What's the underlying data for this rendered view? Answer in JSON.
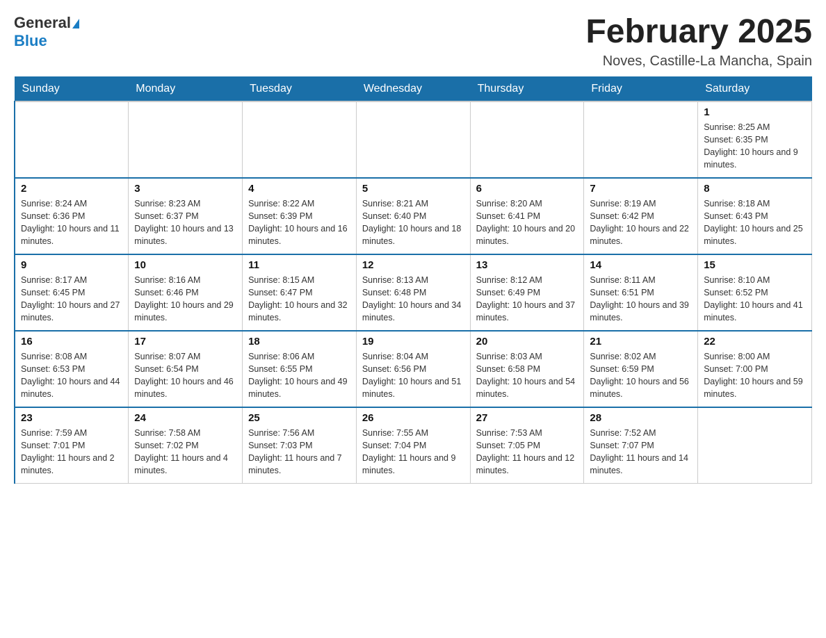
{
  "header": {
    "logo_general": "General",
    "logo_blue": "Blue",
    "title": "February 2025",
    "subtitle": "Noves, Castille-La Mancha, Spain"
  },
  "days_of_week": [
    "Sunday",
    "Monday",
    "Tuesday",
    "Wednesday",
    "Thursday",
    "Friday",
    "Saturday"
  ],
  "weeks": [
    [
      {
        "day": "",
        "info": ""
      },
      {
        "day": "",
        "info": ""
      },
      {
        "day": "",
        "info": ""
      },
      {
        "day": "",
        "info": ""
      },
      {
        "day": "",
        "info": ""
      },
      {
        "day": "",
        "info": ""
      },
      {
        "day": "1",
        "info": "Sunrise: 8:25 AM\nSunset: 6:35 PM\nDaylight: 10 hours and 9 minutes."
      }
    ],
    [
      {
        "day": "2",
        "info": "Sunrise: 8:24 AM\nSunset: 6:36 PM\nDaylight: 10 hours and 11 minutes."
      },
      {
        "day": "3",
        "info": "Sunrise: 8:23 AM\nSunset: 6:37 PM\nDaylight: 10 hours and 13 minutes."
      },
      {
        "day": "4",
        "info": "Sunrise: 8:22 AM\nSunset: 6:39 PM\nDaylight: 10 hours and 16 minutes."
      },
      {
        "day": "5",
        "info": "Sunrise: 8:21 AM\nSunset: 6:40 PM\nDaylight: 10 hours and 18 minutes."
      },
      {
        "day": "6",
        "info": "Sunrise: 8:20 AM\nSunset: 6:41 PM\nDaylight: 10 hours and 20 minutes."
      },
      {
        "day": "7",
        "info": "Sunrise: 8:19 AM\nSunset: 6:42 PM\nDaylight: 10 hours and 22 minutes."
      },
      {
        "day": "8",
        "info": "Sunrise: 8:18 AM\nSunset: 6:43 PM\nDaylight: 10 hours and 25 minutes."
      }
    ],
    [
      {
        "day": "9",
        "info": "Sunrise: 8:17 AM\nSunset: 6:45 PM\nDaylight: 10 hours and 27 minutes."
      },
      {
        "day": "10",
        "info": "Sunrise: 8:16 AM\nSunset: 6:46 PM\nDaylight: 10 hours and 29 minutes."
      },
      {
        "day": "11",
        "info": "Sunrise: 8:15 AM\nSunset: 6:47 PM\nDaylight: 10 hours and 32 minutes."
      },
      {
        "day": "12",
        "info": "Sunrise: 8:13 AM\nSunset: 6:48 PM\nDaylight: 10 hours and 34 minutes."
      },
      {
        "day": "13",
        "info": "Sunrise: 8:12 AM\nSunset: 6:49 PM\nDaylight: 10 hours and 37 minutes."
      },
      {
        "day": "14",
        "info": "Sunrise: 8:11 AM\nSunset: 6:51 PM\nDaylight: 10 hours and 39 minutes."
      },
      {
        "day": "15",
        "info": "Sunrise: 8:10 AM\nSunset: 6:52 PM\nDaylight: 10 hours and 41 minutes."
      }
    ],
    [
      {
        "day": "16",
        "info": "Sunrise: 8:08 AM\nSunset: 6:53 PM\nDaylight: 10 hours and 44 minutes."
      },
      {
        "day": "17",
        "info": "Sunrise: 8:07 AM\nSunset: 6:54 PM\nDaylight: 10 hours and 46 minutes."
      },
      {
        "day": "18",
        "info": "Sunrise: 8:06 AM\nSunset: 6:55 PM\nDaylight: 10 hours and 49 minutes."
      },
      {
        "day": "19",
        "info": "Sunrise: 8:04 AM\nSunset: 6:56 PM\nDaylight: 10 hours and 51 minutes."
      },
      {
        "day": "20",
        "info": "Sunrise: 8:03 AM\nSunset: 6:58 PM\nDaylight: 10 hours and 54 minutes."
      },
      {
        "day": "21",
        "info": "Sunrise: 8:02 AM\nSunset: 6:59 PM\nDaylight: 10 hours and 56 minutes."
      },
      {
        "day": "22",
        "info": "Sunrise: 8:00 AM\nSunset: 7:00 PM\nDaylight: 10 hours and 59 minutes."
      }
    ],
    [
      {
        "day": "23",
        "info": "Sunrise: 7:59 AM\nSunset: 7:01 PM\nDaylight: 11 hours and 2 minutes."
      },
      {
        "day": "24",
        "info": "Sunrise: 7:58 AM\nSunset: 7:02 PM\nDaylight: 11 hours and 4 minutes."
      },
      {
        "day": "25",
        "info": "Sunrise: 7:56 AM\nSunset: 7:03 PM\nDaylight: 11 hours and 7 minutes."
      },
      {
        "day": "26",
        "info": "Sunrise: 7:55 AM\nSunset: 7:04 PM\nDaylight: 11 hours and 9 minutes."
      },
      {
        "day": "27",
        "info": "Sunrise: 7:53 AM\nSunset: 7:05 PM\nDaylight: 11 hours and 12 minutes."
      },
      {
        "day": "28",
        "info": "Sunrise: 7:52 AM\nSunset: 7:07 PM\nDaylight: 11 hours and 14 minutes."
      },
      {
        "day": "",
        "info": ""
      }
    ]
  ]
}
